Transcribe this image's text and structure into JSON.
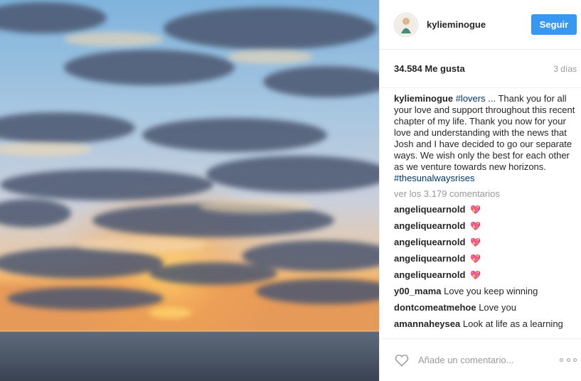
{
  "header": {
    "username": "kylieminogue",
    "follow_label": "Seguir"
  },
  "stats": {
    "likes": "34.584 Me gusta",
    "time": "3 días"
  },
  "caption": {
    "username": "kylieminogue",
    "hashtag1": "#lovers",
    "text": " ... Thank you for all your love and support throughout this recent chapter of my life. Thank you now for your love and understanding with the news that Josh and I have decided to go our separate ways. We wish only the best for each other as we venture towards new horizons.",
    "hashtag2": "#thesunalwaysrises"
  },
  "view_all": "ver los 3.179 comentarios",
  "comments": [
    {
      "user": "angeliquearnold",
      "text": "💖"
    },
    {
      "user": "angeliquearnold",
      "text": "💖"
    },
    {
      "user": "angeliquearnold",
      "text": "💖"
    },
    {
      "user": "angeliquearnold",
      "text": "💖"
    },
    {
      "user": "angeliquearnold",
      "text": "💖"
    },
    {
      "user": "y00_mama",
      "text": "Love you keep winning"
    },
    {
      "user": "dontcomeatmehoe",
      "text": "Love you"
    },
    {
      "user": "amannaheysea",
      "text": "Look at life as a learning"
    }
  ],
  "footer": {
    "comment_placeholder": "Añade un comentario...",
    "like_icon": "heart-outline-icon",
    "more_icon": "more-options-icon"
  },
  "colors": {
    "accent": "#3897f0",
    "hashtag": "#003569",
    "muted": "#999999"
  }
}
